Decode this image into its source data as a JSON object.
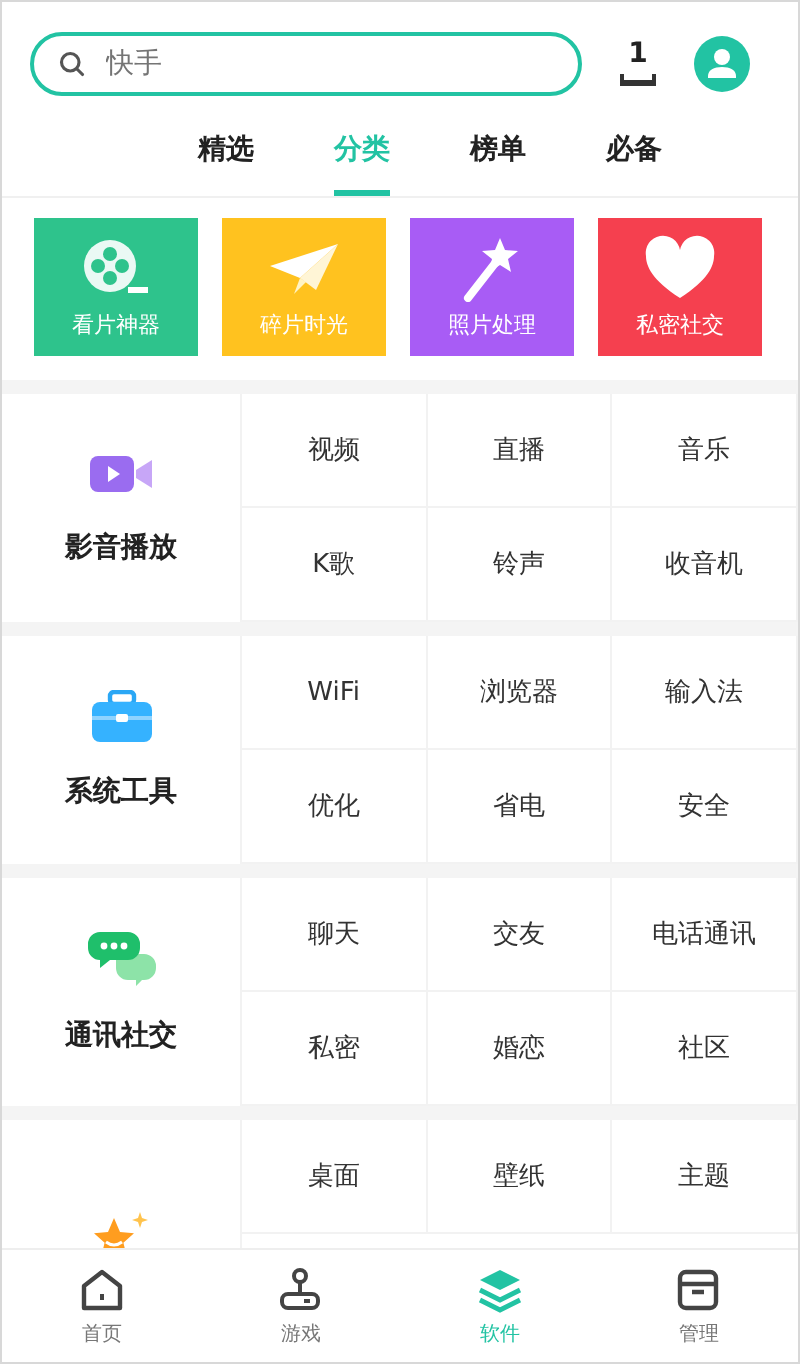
{
  "search": {
    "placeholder": "快手"
  },
  "download_badge": "1",
  "tabs": [
    {
      "label": "精选",
      "selected": false
    },
    {
      "label": "分类",
      "selected": true
    },
    {
      "label": "榜单",
      "selected": false
    },
    {
      "label": "必备",
      "selected": false
    }
  ],
  "tiles": [
    {
      "label": "看片神器",
      "kind": "film",
      "color": "#2ec38c"
    },
    {
      "label": "碎片时光",
      "kind": "plane",
      "color": "#ffc21f"
    },
    {
      "label": "照片处理",
      "kind": "wand",
      "color": "#a85cf5"
    },
    {
      "label": "私密社交",
      "kind": "heart",
      "color": "#f5404f"
    }
  ],
  "categories": [
    {
      "name": "影音播放",
      "kind": "video",
      "items": [
        "视频",
        "直播",
        "音乐",
        "K歌",
        "铃声",
        "收音机"
      ]
    },
    {
      "name": "系统工具",
      "kind": "toolbox",
      "items": [
        "WiFi",
        "浏览器",
        "输入法",
        "优化",
        "省电",
        "安全"
      ]
    },
    {
      "name": "通讯社交",
      "kind": "chat",
      "items": [
        "聊天",
        "交友",
        "电话通讯",
        "私密",
        "婚恋",
        "社区"
      ]
    },
    {
      "kind": "star",
      "items": [
        "桌面",
        "壁纸",
        "主题"
      ]
    }
  ],
  "bottom_nav": [
    {
      "label": "首页",
      "kind": "home",
      "selected": false
    },
    {
      "label": "游戏",
      "kind": "joystick",
      "selected": false
    },
    {
      "label": "软件",
      "kind": "layers",
      "selected": true
    },
    {
      "label": "管理",
      "kind": "box",
      "selected": false
    }
  ]
}
